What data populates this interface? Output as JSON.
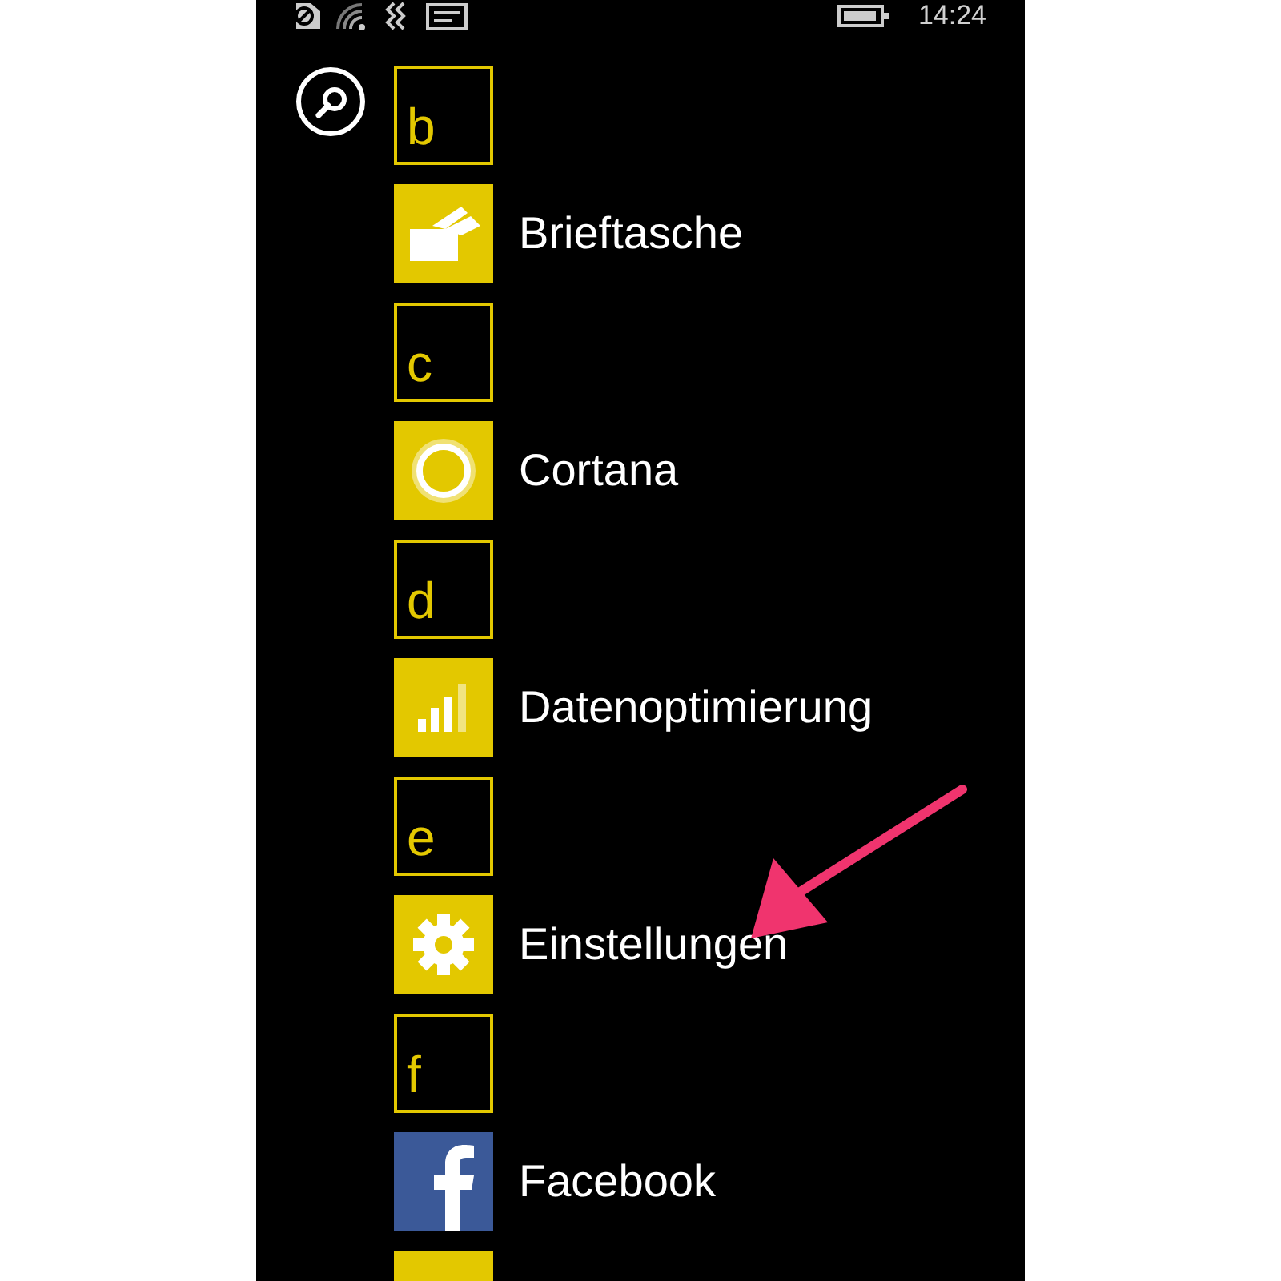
{
  "status_bar": {
    "time": "14:24"
  },
  "items": [
    {
      "kind": "letter",
      "label": "b"
    },
    {
      "kind": "app",
      "label": "Brieftasche",
      "color": "#e3c800"
    },
    {
      "kind": "letter",
      "label": "c"
    },
    {
      "kind": "app",
      "label": "Cortana",
      "color": "#e3c800"
    },
    {
      "kind": "letter",
      "label": "d"
    },
    {
      "kind": "app",
      "label": "Datenoptimierung",
      "color": "#e3c800"
    },
    {
      "kind": "letter",
      "label": "e"
    },
    {
      "kind": "app",
      "label": "Einstellungen",
      "color": "#e3c800"
    },
    {
      "kind": "letter",
      "label": "f"
    },
    {
      "kind": "app",
      "label": "Facebook",
      "color": "#3b5998"
    },
    {
      "kind": "edge",
      "color": "#e3c800"
    }
  ]
}
